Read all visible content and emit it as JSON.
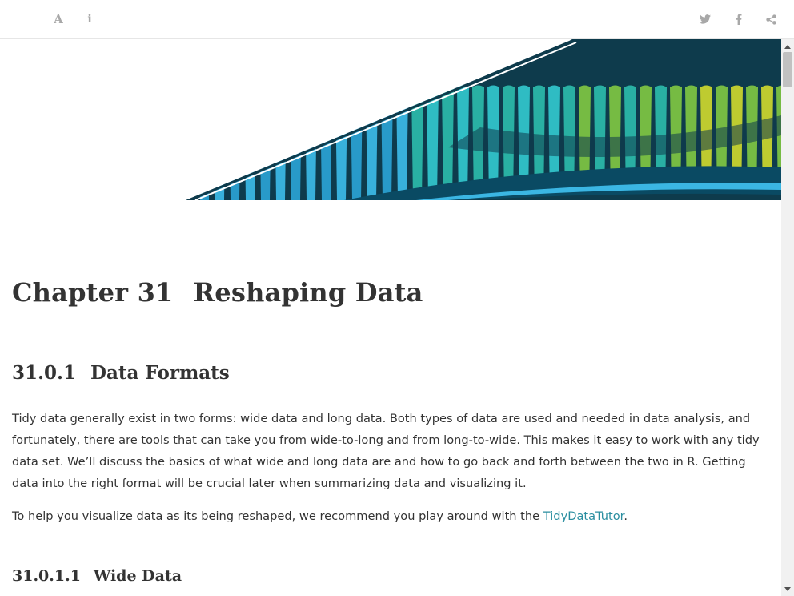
{
  "toolbar": {
    "left_icons": [
      "font-settings-icon",
      "info-icon"
    ],
    "right_icons": [
      "twitter-icon",
      "facebook-icon",
      "share-icon"
    ]
  },
  "chapter": {
    "number": "Chapter 31",
    "title": "Reshaping Data"
  },
  "section": {
    "number": "31.0.1",
    "title": "Data Formats"
  },
  "paragraph1": "Tidy data generally exist in two forms: wide data and long data. Both types of data are used and needed in data analysis, and fortunately, there are tools that can take you from wide-to-long and from long-to-wide. This makes it easy to work with any tidy data set. We’ll discuss the basics of what wide and long data are and how to go back and forth between the two in R. Getting data into the right format will be crucial later when summarizing data and visualizing it.",
  "paragraph2": {
    "before": "To help you visualize data as its being reshaped, we recommend you play around with the ",
    "link": "TidyDataTutor",
    "after": "."
  },
  "subsection": {
    "number": "31.0.1.1",
    "title": "Wide Data"
  },
  "colors": {
    "link": "#2a8ea0",
    "banner_dark": "#0e3b4c",
    "banner_blue": "#3bb6e3",
    "banner_green": "#7cc242",
    "banner_yellow": "#c8d32e"
  }
}
